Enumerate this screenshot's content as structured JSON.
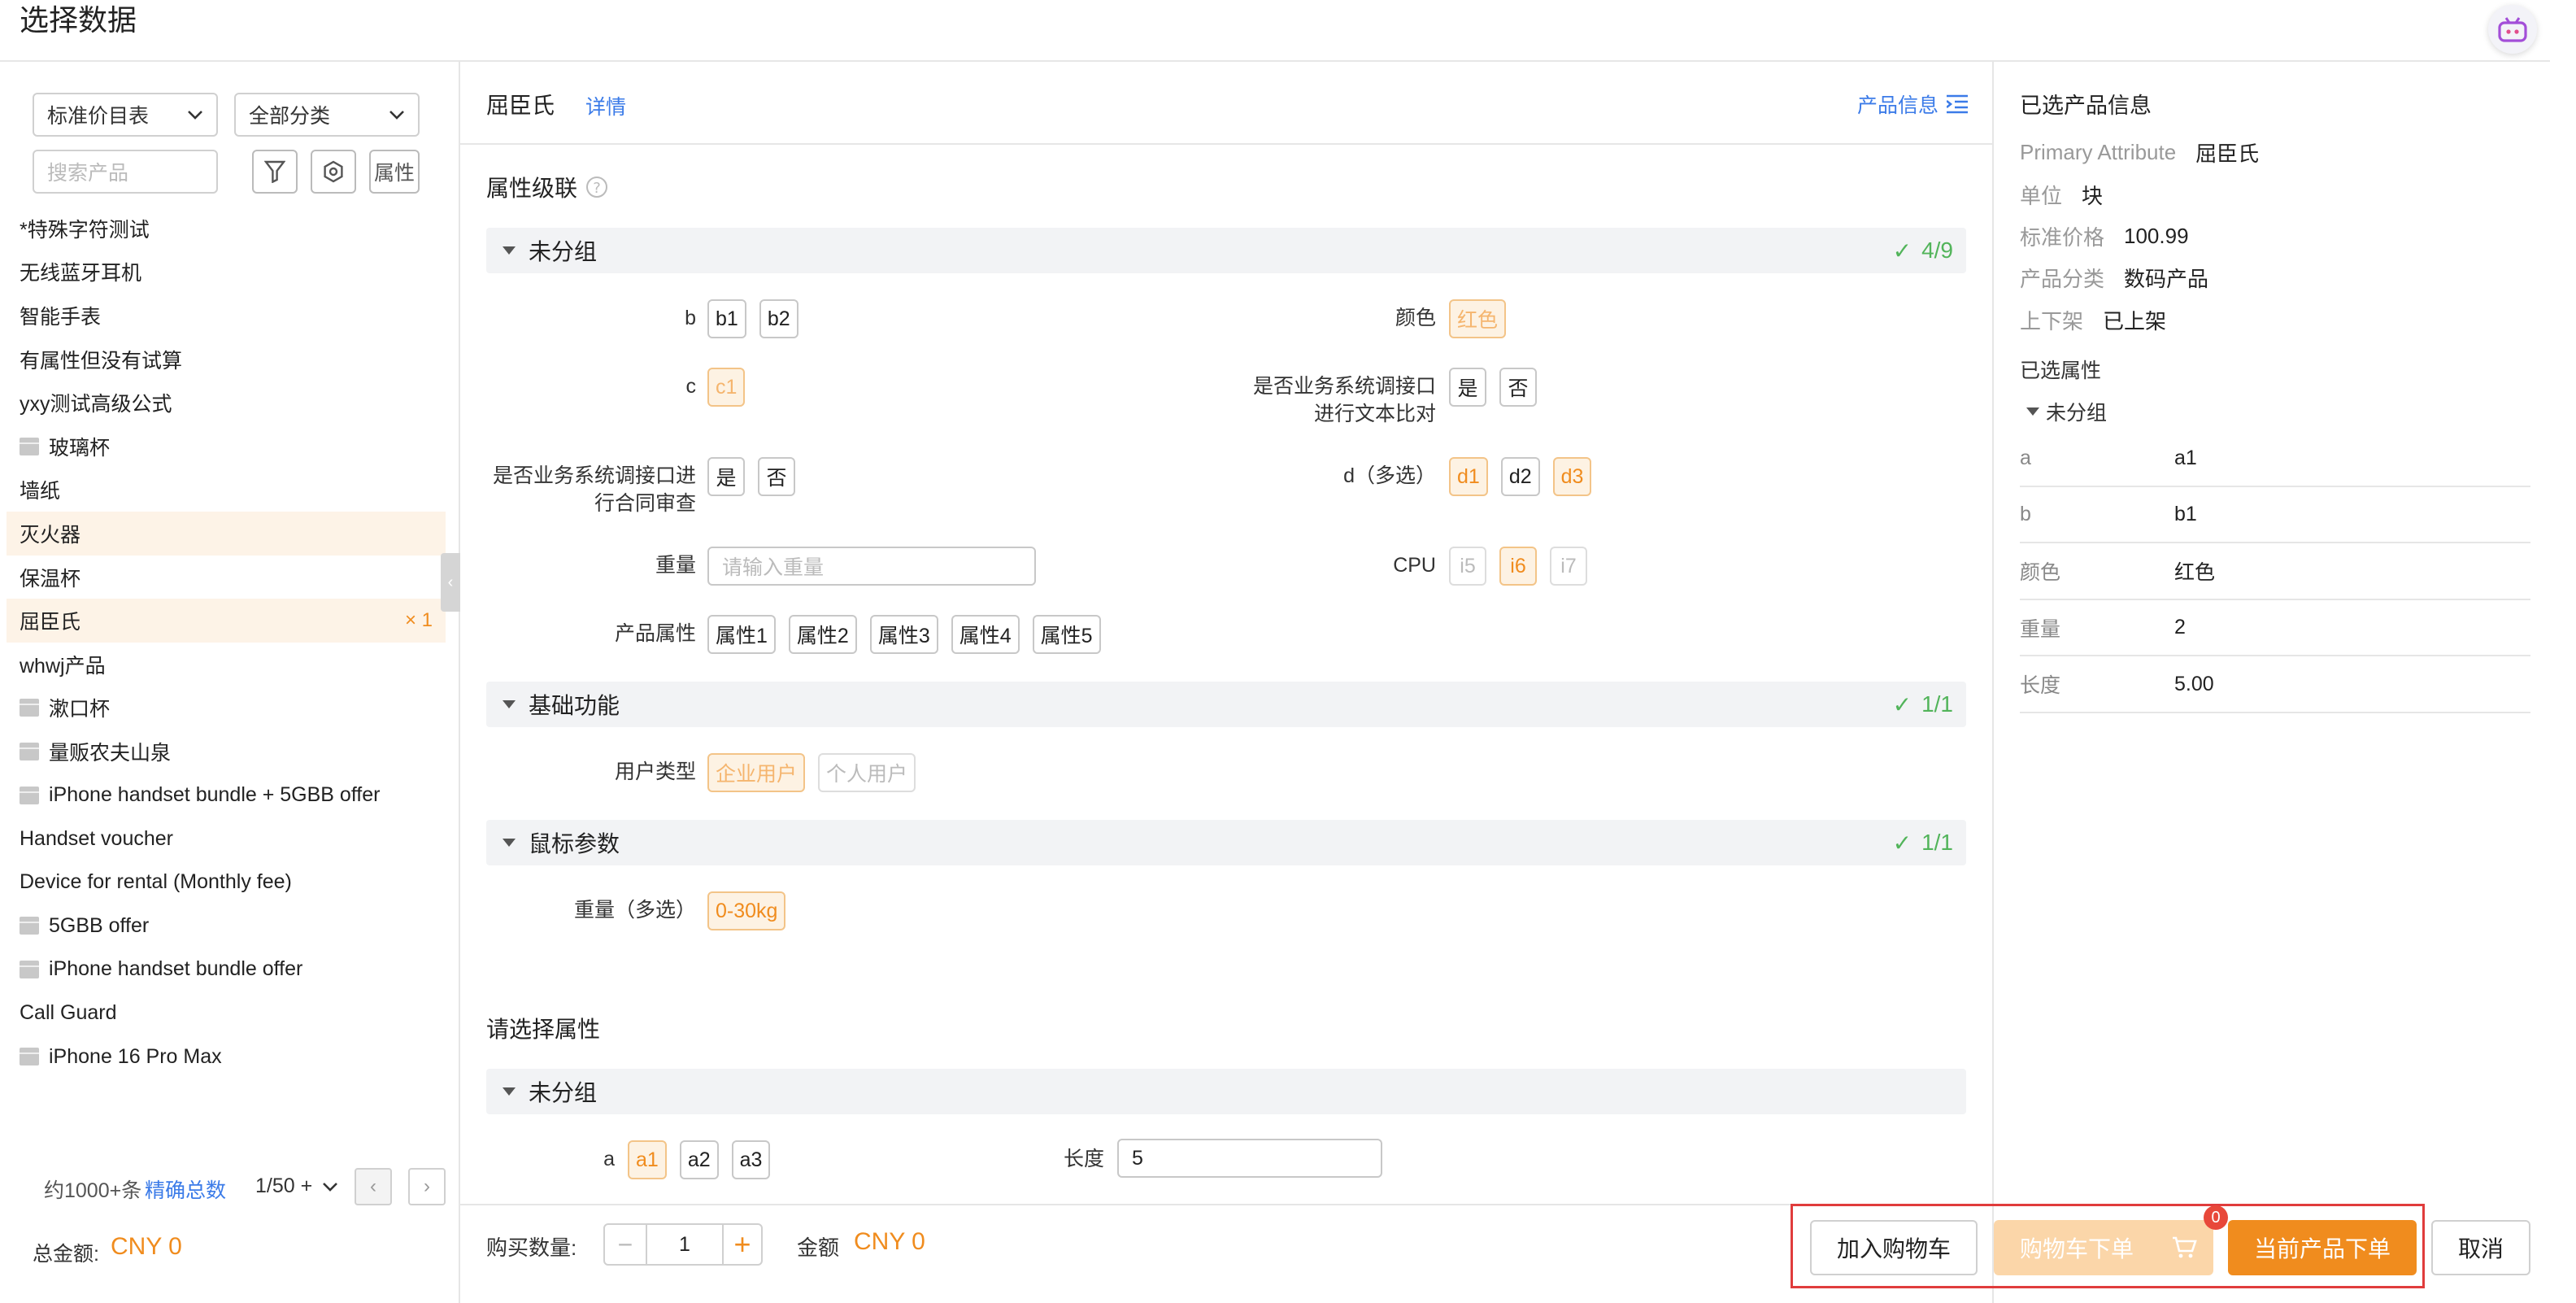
{
  "window_title": "选择数据",
  "left": {
    "price_list_select": "标准价目表",
    "category_select": "全部分类",
    "search_placeholder": "搜索产品",
    "attr_button": "属性",
    "products": [
      {
        "name": "*特殊字符测试",
        "bundle": false,
        "highlight": false,
        "count": ""
      },
      {
        "name": "无线蓝牙耳机",
        "bundle": false,
        "highlight": false,
        "count": ""
      },
      {
        "name": "智能手表",
        "bundle": false,
        "highlight": false,
        "count": ""
      },
      {
        "name": "有属性但没有试算",
        "bundle": false,
        "highlight": false,
        "count": ""
      },
      {
        "name": "yxy测试高级公式",
        "bundle": false,
        "highlight": false,
        "count": ""
      },
      {
        "name": "玻璃杯",
        "bundle": true,
        "highlight": false,
        "count": ""
      },
      {
        "name": "墙纸",
        "bundle": false,
        "highlight": false,
        "count": ""
      },
      {
        "name": "灭火器",
        "bundle": false,
        "highlight": true,
        "count": ""
      },
      {
        "name": "保温杯",
        "bundle": false,
        "highlight": false,
        "count": ""
      },
      {
        "name": "屈臣氏",
        "bundle": false,
        "highlight": true,
        "count": "× 1"
      },
      {
        "name": "whwj产品",
        "bundle": false,
        "highlight": false,
        "count": ""
      },
      {
        "name": "漱口杯",
        "bundle": true,
        "highlight": false,
        "count": ""
      },
      {
        "name": "量贩农夫山泉",
        "bundle": true,
        "highlight": false,
        "count": ""
      },
      {
        "name": "iPhone handset bundle + 5GBB offer",
        "bundle": true,
        "highlight": false,
        "count": ""
      },
      {
        "name": "Handset voucher",
        "bundle": false,
        "highlight": false,
        "count": ""
      },
      {
        "name": "Device for rental (Monthly fee)",
        "bundle": false,
        "highlight": false,
        "count": ""
      },
      {
        "name": "5GBB offer",
        "bundle": true,
        "highlight": false,
        "count": ""
      },
      {
        "name": "iPhone handset bundle offer",
        "bundle": true,
        "highlight": false,
        "count": ""
      },
      {
        "name": "Call Guard",
        "bundle": false,
        "highlight": false,
        "count": ""
      },
      {
        "name": "iPhone 16 Pro Max",
        "bundle": true,
        "highlight": false,
        "count": ""
      }
    ],
    "total_approx": "约1000+条",
    "exact_total_link": "精确总数",
    "page_size": "1/50 +",
    "total_amount_label": "总金额:",
    "total_amount_value": "CNY 0"
  },
  "middle": {
    "product_name": "屈臣氏",
    "detail_link": "详情",
    "product_info_link": "产品信息",
    "cascade_title": "属性级联",
    "groups": {
      "ungrouped": {
        "name": "未分组",
        "progress": "4/9"
      },
      "basic": {
        "name": "基础功能",
        "progress": "1/1"
      },
      "mouse": {
        "name": "鼠标参数",
        "progress": "1/1"
      }
    },
    "attrs": {
      "b_label": "b",
      "b1": "b1",
      "b2": "b2",
      "color_label": "颜色",
      "color_red": "红色",
      "c_label": "c",
      "c1": "c1",
      "text_compare_label": "是否业务系统调接口进行文本比对",
      "yes1": "是",
      "no1": "否",
      "contract_label": "是否业务系统调接口进行合同审查",
      "yes2": "是",
      "no2": "否",
      "d_label": "d（多选）",
      "d1": "d1",
      "d2": "d2",
      "d3": "d3",
      "weight_label": "重量",
      "weight_placeholder": "请输入重量",
      "cpu_label": "CPU",
      "i5": "i5",
      "i6": "i6",
      "i7": "i7",
      "prod_attr_label": "产品属性",
      "pa1": "属性1",
      "pa2": "属性2",
      "pa3": "属性3",
      "pa4": "属性4",
      "pa5": "属性5",
      "user_type_label": "用户类型",
      "enterprise": "企业用户",
      "personal": "个人用户",
      "weight_multi_label": "重量（多选）",
      "weight_range": "0-30kg"
    },
    "select_attr_title": "请选择属性",
    "group2": {
      "name": "未分组"
    },
    "a_label": "a",
    "a1": "a1",
    "a2": "a2",
    "a3": "a3",
    "length_label": "长度",
    "length_value": "5",
    "qty_label": "购买数量:",
    "qty_value": "1",
    "amount_label": "金额",
    "amount_value": "CNY 0"
  },
  "right": {
    "title": "已选产品信息",
    "info": [
      {
        "k": "Primary Attribute",
        "v": "屈臣氏"
      },
      {
        "k": "单位",
        "v": "块"
      },
      {
        "k": "标准价格",
        "v": "100.99"
      },
      {
        "k": "产品分类",
        "v": "数码产品"
      },
      {
        "k": "上下架",
        "v": "已上架"
      }
    ],
    "selected_attrs_title": "已选属性",
    "group": "未分组",
    "attrs": [
      {
        "k": "a",
        "v": "a1"
      },
      {
        "k": "b",
        "v": "b1"
      },
      {
        "k": "颜色",
        "v": "红色"
      },
      {
        "k": "重量",
        "v": "2"
      },
      {
        "k": "长度",
        "v": "5.00"
      }
    ]
  },
  "footer": {
    "add_cart": "加入购物车",
    "cart_order": "购物车下单",
    "cart_badge": "0",
    "current_order": "当前产品下单",
    "cancel": "取消"
  },
  "colors": {
    "accent": "#f08c1e",
    "link": "#3b7be8",
    "success": "#52b45a",
    "highlight_box": "#e03c3c"
  }
}
